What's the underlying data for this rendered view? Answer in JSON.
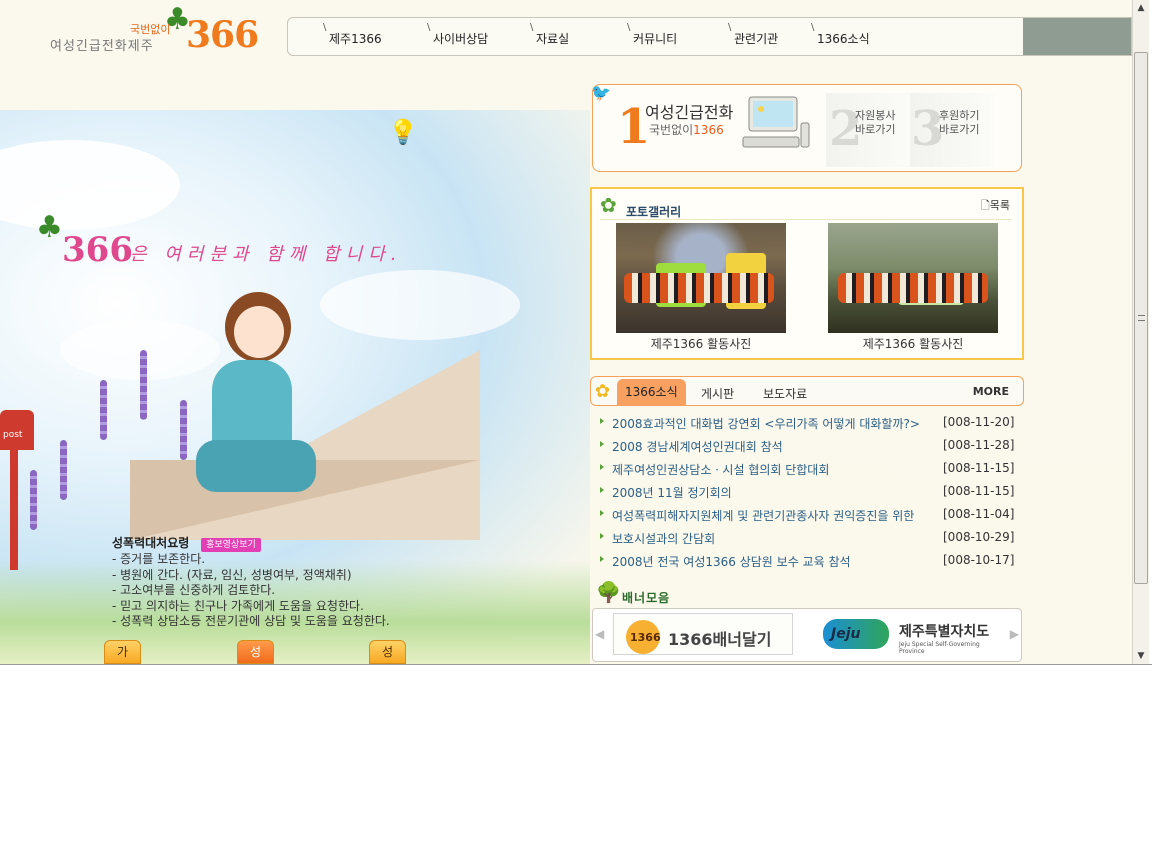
{
  "header": {
    "logo_small": "국번없이",
    "logo_main": "여성긴급전화제주",
    "logo_number": "366",
    "nav": [
      "제주1366",
      "사이버상담",
      "자료실",
      "커뮤니티",
      "관련기관",
      "1366소식"
    ]
  },
  "hero": {
    "slogan_number": "366",
    "slogan_text": "은 여러분과 함께 합니다.",
    "mailbox_label": "post"
  },
  "guide": {
    "title": "성폭력대처요령",
    "badge": "홍보영상보기",
    "lines": [
      "- 증거를 보존한다.",
      "- 병원에 간다. (자료, 임신, 성병여부, 정액채취)",
      "- 고소여부를 신중하게 검토한다.",
      "- 믿고 의지하는 친구나 가족에게 도움을 요청한다.",
      "- 성폭력 상담소등 전문기관에 상담 및 도움을 요청한다."
    ],
    "tabs": [
      "가정폭력대처요령",
      "성폭력피해대처요령",
      "성매매피해대처요령"
    ],
    "active_tab": 1
  },
  "quick": {
    "item1_number": "1",
    "item1_title": "여성긴급전화",
    "item1_sub_prefix": "국번없이",
    "item1_sub_num": "1366",
    "item2_number": "2",
    "item2_line1": "자원봉사",
    "item2_line2": "바로가기",
    "item3_number": "3",
    "item3_line1": "후원하기",
    "item3_line2": "바로가기"
  },
  "gallery": {
    "title": "포토갤러리",
    "list_label": "목록",
    "items": [
      {
        "caption": "제주1366 활동사진"
      },
      {
        "caption": "제주1366 활동사진"
      }
    ]
  },
  "news": {
    "tabs": [
      "1366소식",
      "게시판",
      "보도자료"
    ],
    "active_tab": 0,
    "more_label": "MORE",
    "rows": [
      {
        "title": "2008효과적인 대화법 강연회 <우리가족 어떻게 대화할까?>",
        "date": "[008-11-20]"
      },
      {
        "title": "2008 경남세계여성인권대회 참석",
        "date": "[008-11-28]"
      },
      {
        "title": "제주여성인권상담소ㆍ시설 협의회 단합대회",
        "date": "[008-11-15]"
      },
      {
        "title": "2008년 11월 정기회의",
        "date": "[008-11-15]"
      },
      {
        "title": "여성폭력피해자지원체계 및 관련기관종사자 권익증진을 위한",
        "date": "[008-11-04]"
      },
      {
        "title": "보호시설과의 간담회",
        "date": "[008-10-29]"
      },
      {
        "title": "2008년 전국 여성1366 상담원 보수 교육 참석",
        "date": "[008-10-17]"
      }
    ]
  },
  "banners": {
    "title": "배너모음",
    "banner1_num": "1366",
    "banner1_text": "1366배너달기",
    "banner2_logo": "Jeju",
    "banner2_text": "제주특별자치도",
    "banner2_sub": "Jeju Special Self-Governing Province"
  },
  "colors": {
    "accent_orange": "#f07b1f",
    "slogan_pink": "#e0488e",
    "news_link": "#2c5f86",
    "nav_fill": "#8f9c92"
  },
  "icons": [
    "clover-icon",
    "lightbulb-icon",
    "bird-icon",
    "computer-icon",
    "document-icon",
    "flower-icon",
    "tree-icon",
    "arrow-left-icon",
    "arrow-right-icon",
    "scroll-up-icon",
    "scroll-down-icon"
  ]
}
